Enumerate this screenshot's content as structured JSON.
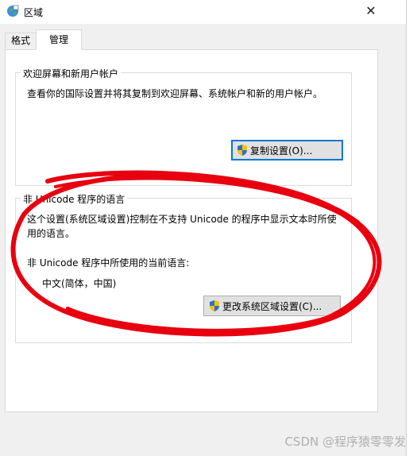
{
  "window": {
    "title": "区域",
    "close_glyph": "✕"
  },
  "tabs": [
    {
      "label": "格式"
    },
    {
      "label": "管理"
    }
  ],
  "welcome_group": {
    "legend": "欢迎屏幕和新用户帐户",
    "description": "查看你的国际设置并将其复制到欢迎屏幕、系统帐户和新的用户帐户。",
    "button_label": "复制设置(O)..."
  },
  "unicode_group": {
    "legend": "非 Unicode 程序的语言",
    "description": "这个设置(系统区域设置)控制在不支持 Unicode 的程序中显示文本时所使用的语言。",
    "current_label": "非 Unicode 程序中所使用的当前语言:",
    "current_value": "中文(简体，中国)",
    "button_label": "更改系统区域设置(C)..."
  },
  "watermark": "CSDN @程序猿零零发",
  "colors": {
    "annotation": "#e8000f",
    "accent": "#0078d7"
  },
  "icons": {
    "app": "globe-icon",
    "shield": "uac-shield-icon"
  }
}
